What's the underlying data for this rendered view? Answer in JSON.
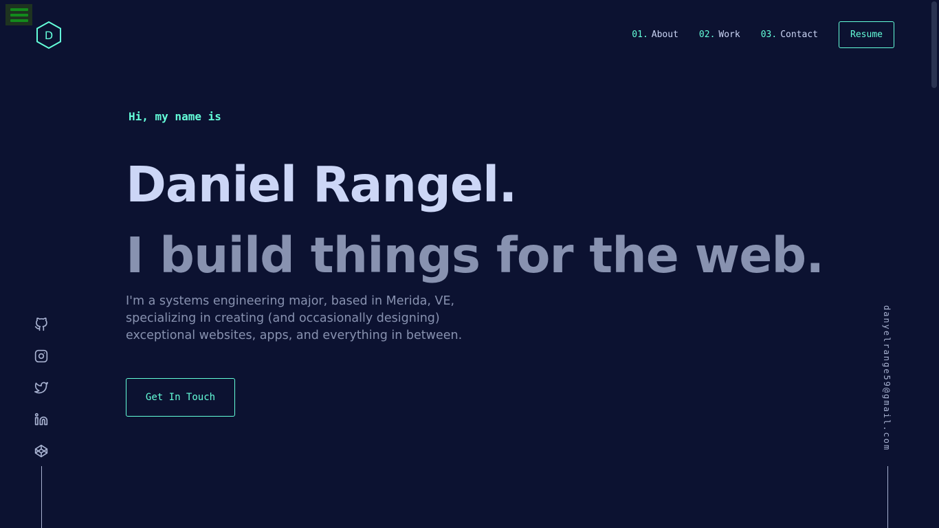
{
  "logo": {
    "letter": "D"
  },
  "nav": {
    "items": [
      {
        "num": "01.",
        "label": "About"
      },
      {
        "num": "02.",
        "label": "Work"
      },
      {
        "num": "03.",
        "label": "Contact"
      }
    ],
    "resume_label": "Resume"
  },
  "hero": {
    "greeting": "Hi, my name is",
    "name": "Daniel Rangel.",
    "tagline": "I build things for the web.",
    "description": "I'm a systems engineering major, based in Merida, VE, specializing in creating (and occasionally designing) exceptional websites, apps, and everything in between.",
    "cta_label": "Get In Touch"
  },
  "social": [
    "github-icon",
    "instagram-icon",
    "twitter-icon",
    "linkedin-icon",
    "codepen-icon"
  ],
  "email": "danyelrange59@gmail.com",
  "colors": {
    "background": "#0c1231",
    "accent": "#64ffda",
    "heading": "#ccd6f6",
    "text": "#8892b0"
  }
}
